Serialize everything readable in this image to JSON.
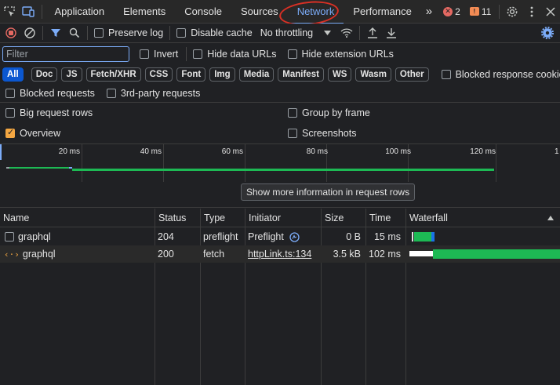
{
  "tabbar": {
    "tabs": [
      "Application",
      "Elements",
      "Console",
      "Sources",
      "Network",
      "Performance"
    ],
    "active_tab": "Network",
    "more_glyph": "»",
    "errors": "2",
    "warnings": "11"
  },
  "toolbar": {
    "preserve_log": "Preserve log",
    "disable_cache": "Disable cache",
    "throttling": "No throttling"
  },
  "filter": {
    "placeholder": "Filter",
    "invert": "Invert",
    "hide_data_urls": "Hide data URLs",
    "hide_extension_urls": "Hide extension URLs"
  },
  "chips": [
    "All",
    "Doc",
    "JS",
    "Fetch/XHR",
    "CSS",
    "Font",
    "Img",
    "Media",
    "Manifest",
    "WS",
    "Wasm",
    "Other"
  ],
  "active_chip": "All",
  "blocked_response_cookies": "Blocked response cookies",
  "blocked_requests": "Blocked requests",
  "third_party_requests": "3rd-party requests",
  "settings": {
    "big_request_rows": "Big request rows",
    "group_by_frame": "Group by frame",
    "overview": "Overview",
    "overview_checked": true,
    "screenshots": "Screenshots"
  },
  "overview": {
    "ticks": [
      "20 ms",
      "40 ms",
      "60 ms",
      "80 ms",
      "100 ms",
      "120 ms",
      "1"
    ],
    "tooltip": "Show more information in request rows"
  },
  "table": {
    "columns": [
      "Name",
      "Status",
      "Type",
      "Initiator",
      "Size",
      "Time",
      "Waterfall"
    ],
    "rows": [
      {
        "name": "graphql",
        "status": "204",
        "type": "preflight",
        "initiator": "Preflight",
        "size": "0 B",
        "time": "15 ms"
      },
      {
        "name": "graphql",
        "status": "200",
        "type": "fetch",
        "initiator": "httpLink.ts:134",
        "size": "3.5 kB",
        "time": "102 ms"
      }
    ]
  },
  "colors": {
    "accent": "#7cacf8",
    "waterfall_green": "#1db954",
    "waterfall_blue": "#1a73e8",
    "annotation_red": "#d93025"
  }
}
